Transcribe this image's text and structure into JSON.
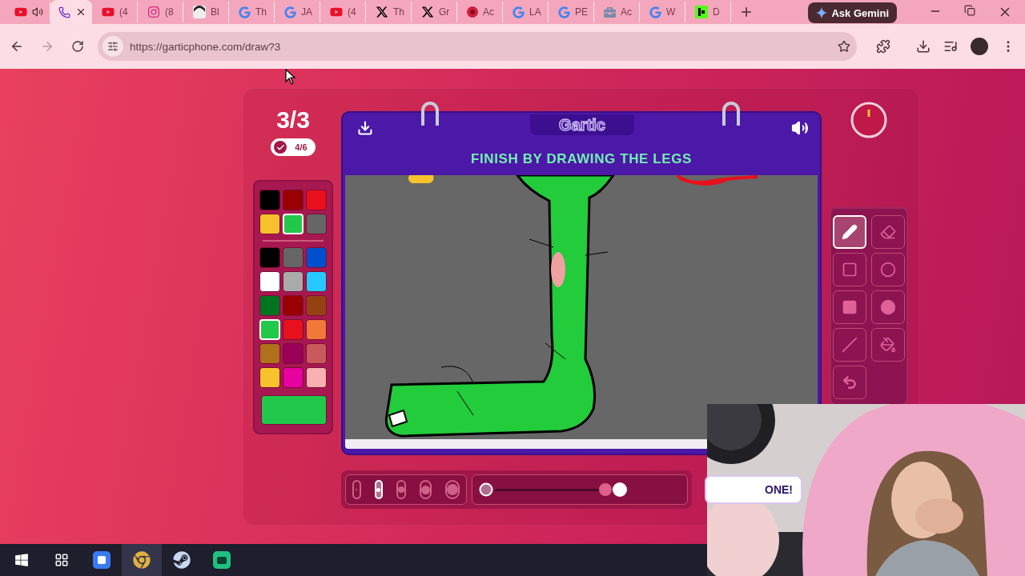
{
  "browser": {
    "tabs": [
      {
        "kind": "youtube",
        "audio": true,
        "selected": false
      },
      {
        "kind": "phone",
        "audio": false,
        "selected": true
      },
      {
        "kind": "youtube",
        "title": "(4",
        "audio": false,
        "selected": false
      },
      {
        "kind": "instagram",
        "title": "(8",
        "audio": false,
        "selected": false
      },
      {
        "kind": "avatar",
        "title": "Bl",
        "audio": false,
        "selected": false
      },
      {
        "kind": "google",
        "title": "Th",
        "audio": false,
        "selected": false
      },
      {
        "kind": "google",
        "title": "JA",
        "audio": false,
        "selected": false
      },
      {
        "kind": "youtube",
        "title": "(4",
        "audio": false,
        "selected": false
      },
      {
        "kind": "x",
        "title": "Th",
        "audio": false,
        "selected": false
      },
      {
        "kind": "x",
        "title": "Gr",
        "audio": false,
        "selected": false
      },
      {
        "kind": "swirl",
        "title": "Ac",
        "audio": false,
        "selected": false
      },
      {
        "kind": "google",
        "title": "LA",
        "audio": false,
        "selected": false
      },
      {
        "kind": "google",
        "title": "PE",
        "audio": false,
        "selected": false
      },
      {
        "kind": "briefcase",
        "title": "Ac",
        "audio": false,
        "selected": false
      },
      {
        "kind": "google",
        "title": "W",
        "audio": false,
        "selected": false
      },
      {
        "kind": "kick",
        "title": "D",
        "audio": false,
        "selected": false
      }
    ],
    "gemini_button": "Ask Gemini",
    "address": "https://garticphone.com/draw?3"
  },
  "game": {
    "round": "3/3",
    "done_count": "4/6",
    "logo": "Gartic",
    "prompt": "FINISH BY DRAWING THE LEGS",
    "recent_colors": [
      {
        "color": "#000000",
        "selected": false
      },
      {
        "color": "#990000",
        "selected": false
      },
      {
        "color": "#e8101c",
        "selected": false
      },
      {
        "color": "#f8c22c",
        "selected": false
      },
      {
        "color": "#22c84a",
        "selected": true
      },
      {
        "color": "#666666",
        "selected": false
      }
    ],
    "palette": [
      {
        "color": "#000000",
        "selected": false
      },
      {
        "color": "#666666",
        "selected": false
      },
      {
        "color": "#0050cd",
        "selected": false
      },
      {
        "color": "#ffffff",
        "selected": false
      },
      {
        "color": "#aaaaaa",
        "selected": false
      },
      {
        "color": "#26c9ff",
        "selected": false
      },
      {
        "color": "#017420",
        "selected": false
      },
      {
        "color": "#990000",
        "selected": false
      },
      {
        "color": "#964112",
        "selected": false
      },
      {
        "color": "#22c84a",
        "selected": true
      },
      {
        "color": "#e8101c",
        "selected": false
      },
      {
        "color": "#f07838",
        "selected": false
      },
      {
        "color": "#b0701c",
        "selected": false
      },
      {
        "color": "#990058",
        "selected": false
      },
      {
        "color": "#c85a5e",
        "selected": false
      },
      {
        "color": "#f8c22c",
        "selected": false
      },
      {
        "color": "#e800a0",
        "selected": false
      },
      {
        "color": "#f8b0b0",
        "selected": false
      }
    ],
    "tools": [
      {
        "kind": "pencil",
        "selected": true
      },
      {
        "kind": "eraser",
        "selected": false
      },
      {
        "kind": "rectangle",
        "selected": false
      },
      {
        "kind": "ellipse",
        "selected": false
      },
      {
        "kind": "filled-rectangle",
        "selected": false
      },
      {
        "kind": "filled-ellipse",
        "selected": false
      },
      {
        "kind": "line",
        "selected": false
      },
      {
        "kind": "bucket",
        "selected": false
      },
      {
        "kind": "undo",
        "selected": false
      }
    ],
    "brush_sizes": [
      {
        "selected": false
      },
      {
        "selected": true
      },
      {
        "selected": false
      },
      {
        "selected": false
      },
      {
        "selected": false
      }
    ],
    "opacity": {
      "level": 1
    },
    "done_button": "ONE!"
  },
  "taskbar": {
    "apps": [
      {
        "kind": "start"
      },
      {
        "kind": "task-view"
      },
      {
        "kind": "blue-app"
      },
      {
        "kind": "chrome"
      },
      {
        "kind": "steam"
      },
      {
        "kind": "green-app"
      }
    ]
  }
}
